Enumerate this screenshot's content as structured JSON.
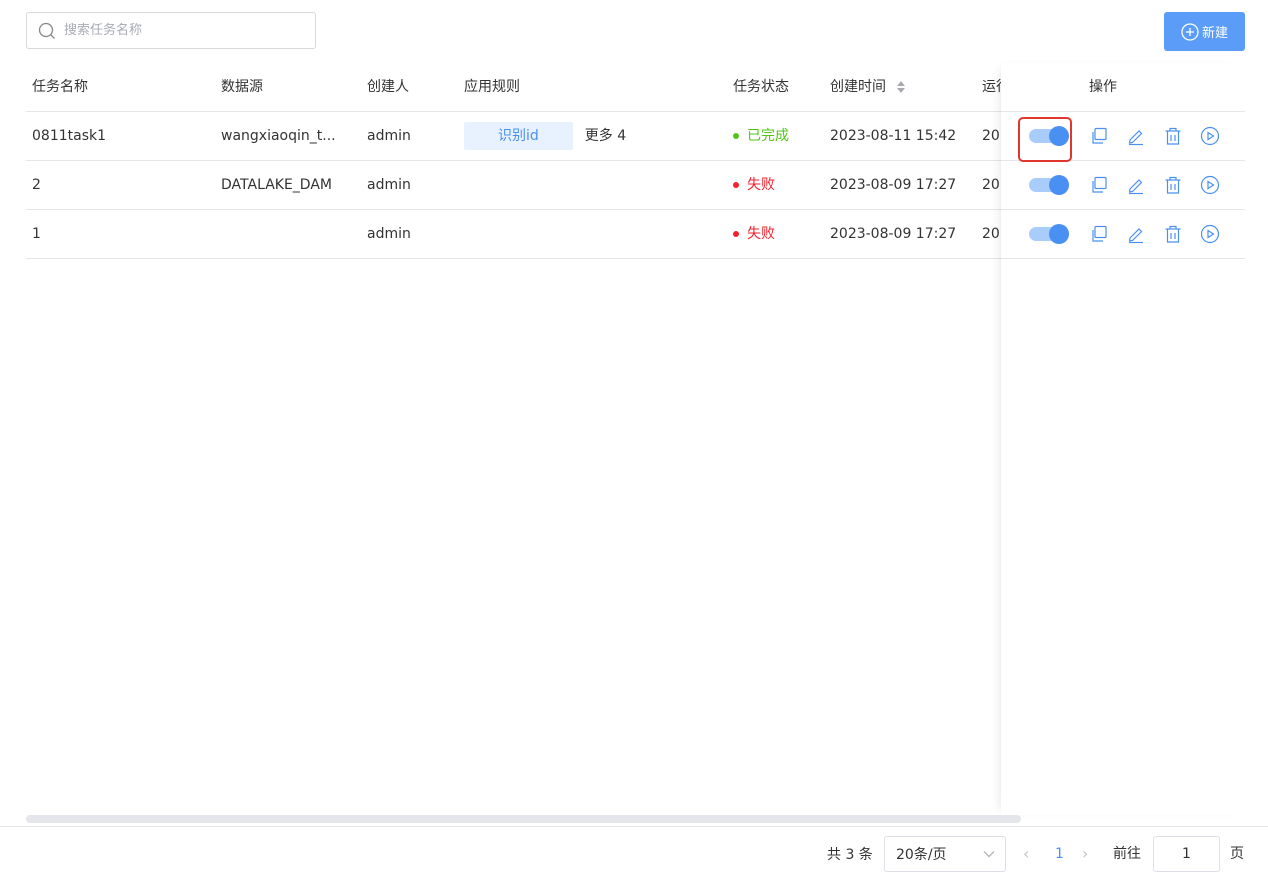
{
  "search": {
    "placeholder": "搜索任务名称",
    "icon": "search-icon"
  },
  "toolbar": {
    "new_label": "新建",
    "new_icon": "plus-circle-icon",
    "accent": "#5a9cf8"
  },
  "table": {
    "columns": [
      "任务名称",
      "数据源",
      "创建人",
      "应用规则",
      "任务状态",
      "创建时间",
      "运行",
      "操作"
    ],
    "rows": [
      {
        "name": "0811task1",
        "source": "wangxiaoqin_t...",
        "creator": "admin",
        "rule_tag": "识别id",
        "rule_more": "更多 4",
        "status": "已完成",
        "status_type": "success",
        "created": "2023-08-11 15:42",
        "run": "20"
      },
      {
        "name": "2",
        "source": "DATALAKE_DAM",
        "creator": "admin",
        "rule_tag": "",
        "rule_more": "",
        "status": "失败",
        "status_type": "error",
        "created": "2023-08-09 17:27",
        "run": "20"
      },
      {
        "name": "1",
        "source": "",
        "creator": "admin",
        "rule_tag": "",
        "rule_more": "",
        "status": "失败",
        "status_type": "error",
        "created": "2023-08-09 17:27",
        "run": "20"
      }
    ],
    "colors": {
      "success": "#52c41a",
      "error": "#f5222d",
      "tag_bg": "#e8f2ff",
      "tag_text": "#4a90f0"
    }
  },
  "actions": {
    "icons": [
      "toggle-switch",
      "copy-icon",
      "edit-icon",
      "delete-icon",
      "play-icon"
    ],
    "switch_on": true,
    "highlight_color": "#e0362c"
  },
  "pagination": {
    "total_label": "共 3 条",
    "page_size_label": "20条/页",
    "current_page": "1",
    "goto_label": "前往",
    "jump_value": "1",
    "page_unit": "页"
  }
}
